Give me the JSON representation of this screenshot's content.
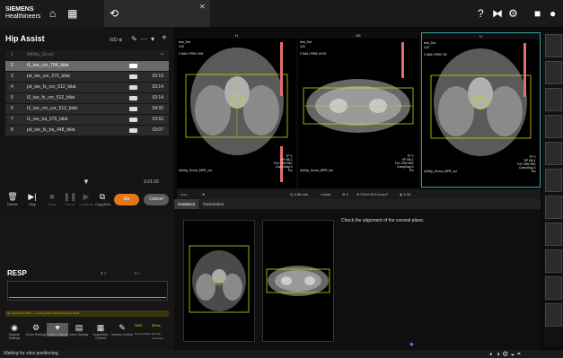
{
  "brand": {
    "name": "SIEMENS",
    "sub": "Healthineers"
  },
  "panel": {
    "title": "Hip Assist",
    "iso": "ISO"
  },
  "protocols": [
    {
      "num": "1",
      "name": "AAHip_Scout",
      "duration": ""
    },
    {
      "num": "2",
      "name": "t1_tse_cor_704_bilat",
      "duration": ""
    },
    {
      "num": "3",
      "name": "pd_tse_cor_576_bilat",
      "duration": "03:10"
    },
    {
      "num": "4",
      "name": "pd_tse_fs_cor_512_bilat",
      "duration": "03:14"
    },
    {
      "num": "5",
      "name": "t2_tse_fs_cor_512_bilat",
      "duration": "03:14"
    },
    {
      "num": "6",
      "name": "t2_tse_cm_cor_512_bilat",
      "duration": "04:32"
    },
    {
      "num": "7",
      "name": "t1_tse_tra_576_bilat",
      "duration": "03:53"
    },
    {
      "num": "8",
      "name": "pd_tse_fs_tra_448_bilat",
      "duration": "03:07"
    }
  ],
  "total_time": "3:21:10",
  "controls": [
    "Delete",
    "Skip",
    "Stop",
    "Pause",
    "Continue",
    "Copy&Go"
  ],
  "go_label": "Go",
  "cancel_label": "Cancel",
  "resp": {
    "label": "RESP",
    "rate1": "0",
    "rate2": "0"
  },
  "warning": "No signal from PMU — Leaving PMU Signal Detection Mode",
  "bottom_buttons": [
    "Scanner Settings",
    "Exam Settings",
    "Patient Display",
    "Inline Display",
    "Acquisition Context",
    "Injector Control"
  ],
  "sar": {
    "label": "SAR",
    "normal": "Normal Mode",
    "loudness": "50ms",
    "loud_sub": "Normal Loudness"
  },
  "status": "Waiting for slice positioning.",
  "viewports": [
    {
      "orient": "H",
      "name": "test_Dot",
      "id": "123",
      "meta": "2 IMA t FRM 13/5",
      "label": "AAHip_Scout_MPR_cor",
      "right": "TP 0\nSP H8.1\nFoV 450*450\nCompSag 3\nTra"
    },
    {
      "orient": "AR",
      "name": "test_Dot",
      "id": "123",
      "meta": "2 IMA t FRM 13/15",
      "label": "AAHip_Scout_MPR_tra",
      "right": "TP 0\nSP H8.1\nFoV 450*450\nCompSag 3\nTra"
    },
    {
      "orient": "H",
      "name": "test_Dot",
      "id": "123",
      "meta": "2 IMA t FRM 7/8",
      "label": "AAHip_Scout_MPR_cor",
      "right": "TP 0\nSP H8.1\nFoV 450*450\nCompSag 3\nTra"
    }
  ],
  "vp_toolbar": {
    "time": "3:46 min",
    "auto": "Auto",
    "count": "2",
    "voxel": "0.5×0.5×3.0 mm³",
    "ratio": "1.00"
  },
  "tabs": [
    "Guidance",
    "Parameters"
  ],
  "guidance_text": "Check the alignment of the coronal plane.",
  "colors": {
    "accent": "#e2781c",
    "active_row": "#6a6a6a",
    "highlight": "#3aa0a0",
    "plan": "#d4d400"
  }
}
